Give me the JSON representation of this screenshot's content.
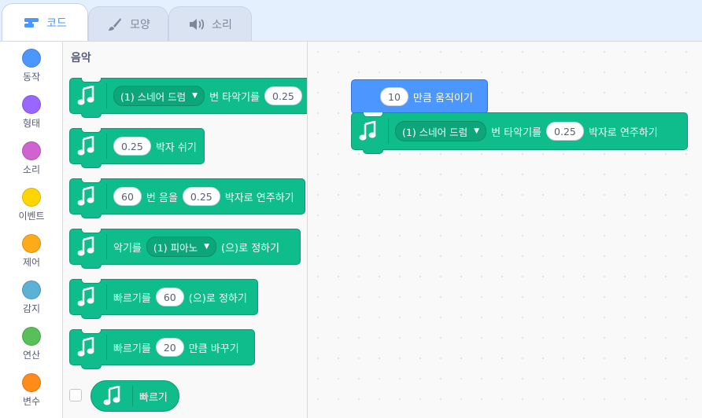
{
  "tabs": [
    {
      "label": "코드",
      "icon": "code-icon",
      "active": true
    },
    {
      "label": "모양",
      "icon": "brush-icon",
      "active": false
    },
    {
      "label": "소리",
      "icon": "speaker-icon",
      "active": false
    }
  ],
  "categories": [
    {
      "label": "동작",
      "color": "#4c97ff"
    },
    {
      "label": "형태",
      "color": "#9966ff"
    },
    {
      "label": "소리",
      "color": "#cf63cf"
    },
    {
      "label": "이벤트",
      "color": "#ffd500"
    },
    {
      "label": "제어",
      "color": "#ffab19"
    },
    {
      "label": "감지",
      "color": "#5cb1d6"
    },
    {
      "label": "연산",
      "color": "#59c059"
    },
    {
      "label": "변수",
      "color": "#ff8c1a"
    }
  ],
  "palette": {
    "title": "음악",
    "blocks": {
      "drum": {
        "dropdown": "(1) 스네어 드럼",
        "text1": "번 타악기를",
        "beats": "0.25"
      },
      "rest": {
        "beats": "0.25",
        "text1": "박자 쉬기"
      },
      "note": {
        "note": "60",
        "text1": "번 음을",
        "beats": "0.25",
        "text2": "박자로 연주하기"
      },
      "instrument": {
        "text1": "악기를",
        "dropdown": "(1) 피아노",
        "text2": "(으)로 정하기"
      },
      "set_tempo": {
        "text1": "빠르기를",
        "value": "60",
        "text2": "(으)로 정하기"
      },
      "change_tempo": {
        "text1": "빠르기를",
        "value": "20",
        "text2": "만큼 바꾸기"
      },
      "tempo_reporter": {
        "text1": "빠르기"
      }
    }
  },
  "workspace": {
    "move": {
      "steps": "10",
      "text1": "만큼 움직이기"
    },
    "drum": {
      "dropdown": "(1) 스네어 드럼",
      "text1": "번 타악기를",
      "beats": "0.25",
      "text2": "박자로 연주하기"
    }
  }
}
